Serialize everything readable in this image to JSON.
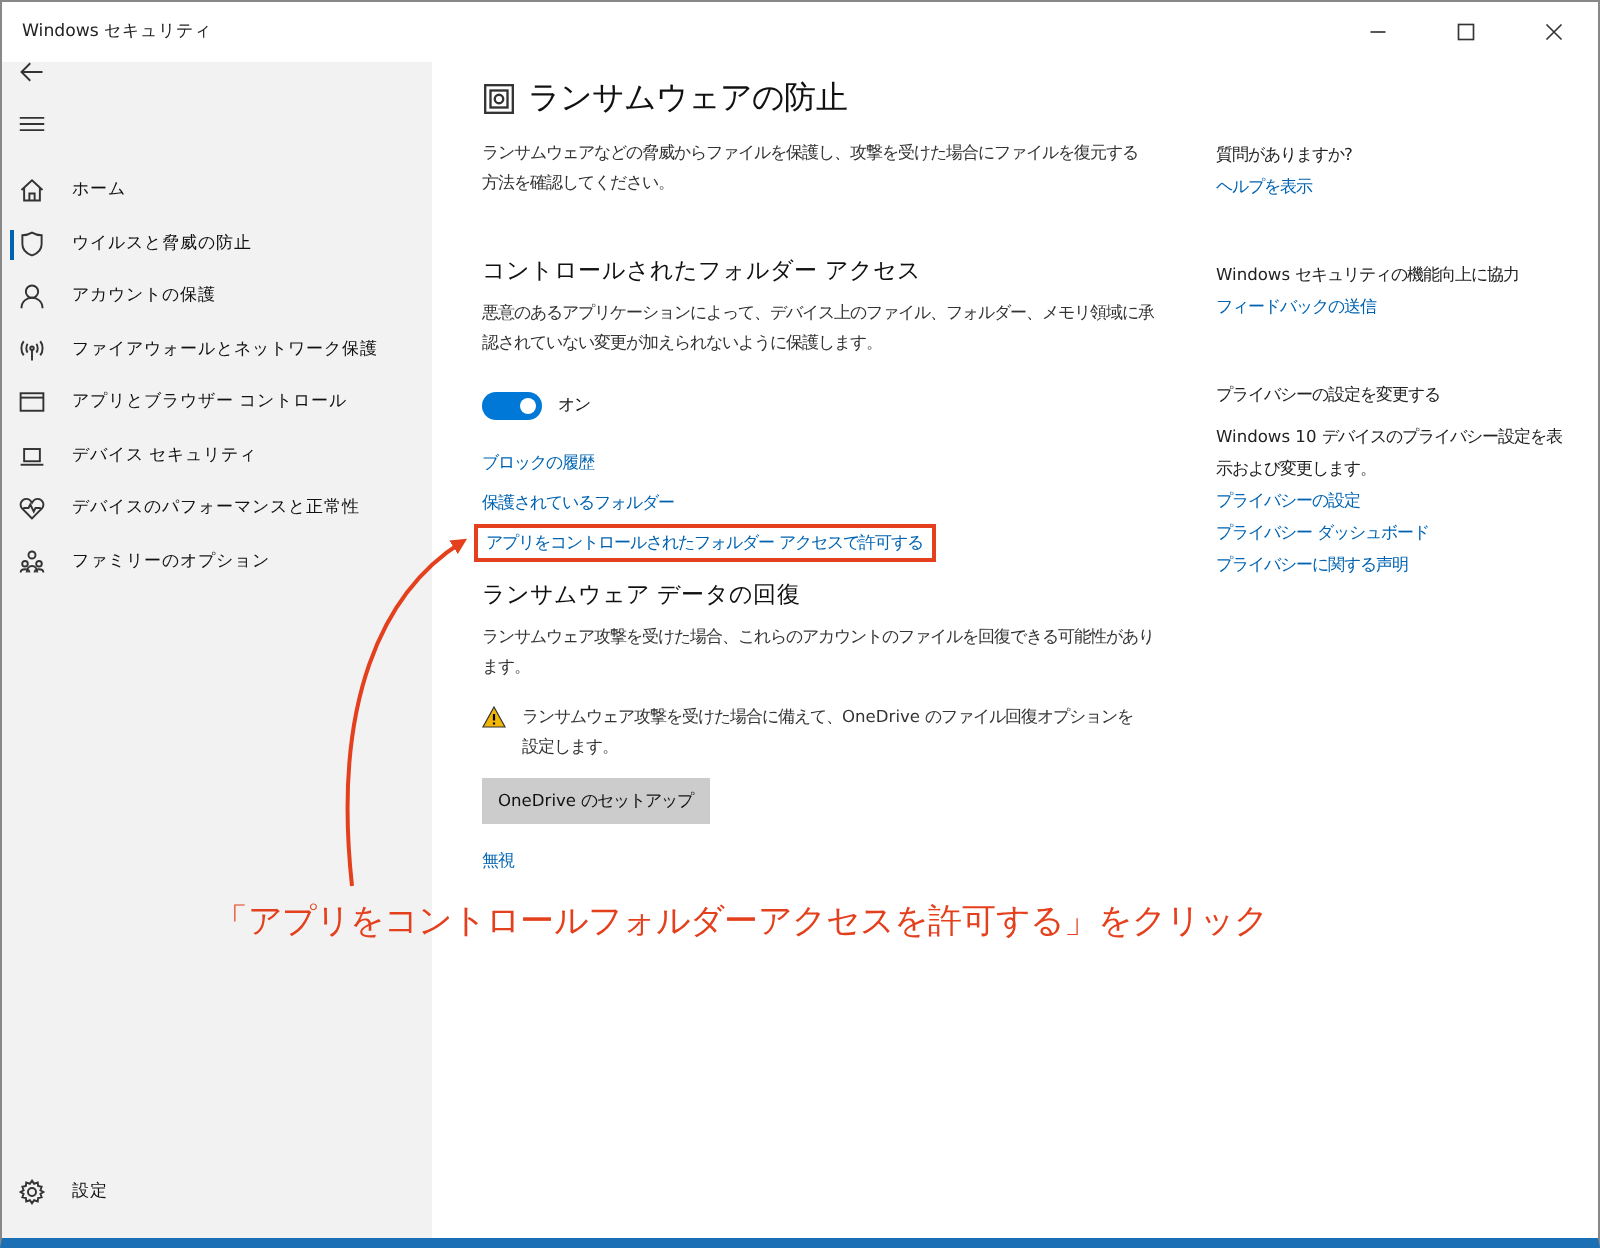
{
  "window": {
    "title": "Windows セキュリティ"
  },
  "sidebar": {
    "items": [
      {
        "kind": "home",
        "label": "ホーム",
        "selected": false
      },
      {
        "kind": "shield",
        "label": "ウイルスと脅威の防止",
        "selected": true
      },
      {
        "kind": "person",
        "label": "アカウントの保護",
        "selected": false
      },
      {
        "kind": "antenna",
        "label": "ファイアウォールとネットワーク保護",
        "selected": false
      },
      {
        "kind": "browser",
        "label": "アプリとブラウザー コントロール",
        "selected": false
      },
      {
        "kind": "laptop",
        "label": "デバイス セキュリティ",
        "selected": false
      },
      {
        "kind": "heart",
        "label": "デバイスのパフォーマンスと正常性",
        "selected": false
      },
      {
        "kind": "family",
        "label": "ファミリーのオプション",
        "selected": false
      }
    ],
    "footer": {
      "label": "設定"
    }
  },
  "main": {
    "title": "ランサムウェアの防止",
    "intro": "ランサムウェアなどの脅威からファイルを保護し、攻撃を受けた場合にファイルを復元する方法を確認してください。",
    "controlled_access": {
      "heading": "コントロールされたフォルダー アクセス",
      "description": "悪意のあるアプリケーションによって、デバイス上のファイル、フォルダー、メモリ領域に承認されていない変更が加えられないように保護します。",
      "toggle": {
        "on": true,
        "label": "オン"
      },
      "links": [
        {
          "label": "ブロックの履歴",
          "highlighted": false
        },
        {
          "label": "保護されているフォルダー",
          "highlighted": false
        },
        {
          "label": "アプリをコントロールされたフォルダー アクセスで許可する",
          "highlighted": true
        }
      ]
    },
    "recovery": {
      "heading": "ランサムウェア データの回復",
      "description": "ランサムウェア攻撃を受けた場合、これらのアカウントのファイルを回復できる可能性があります。",
      "warning": "ランサムウェア攻撃を受けた場合に備えて、OneDrive のファイル回復オプションを設定します。",
      "button": "OneDrive のセットアップ",
      "dismiss": "無視"
    }
  },
  "aside": {
    "sections": [
      {
        "heading": "質問がありますか?",
        "links": [
          "ヘルプを表示"
        ]
      },
      {
        "heading": "Windows セキュリティの機能向上に協力",
        "links": [
          "フィードバックの送信"
        ]
      },
      {
        "heading": "プライバシーの設定を変更する",
        "description": "Windows 10 デバイスのプライバシー設定を表示および変更します。",
        "links": [
          "プライバシーの設定",
          "プライバシー ダッシュボード",
          "プライバシーに関する声明"
        ]
      }
    ]
  },
  "annotation": {
    "callout": "「アプリをコントロールフォルダーアクセスを許可する」をクリック"
  }
}
